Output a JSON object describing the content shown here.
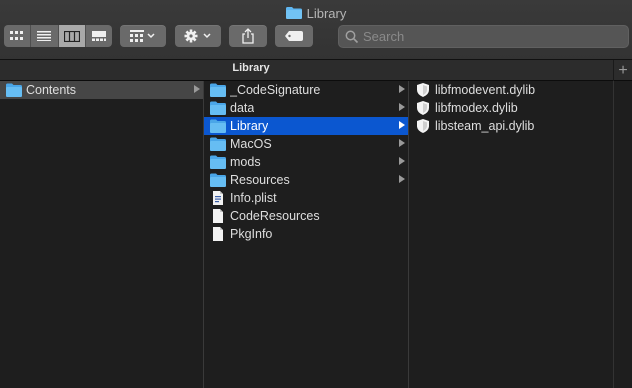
{
  "window": {
    "title": "Library"
  },
  "toolbar": {
    "views": [
      "icon-view",
      "list-view",
      "column-view",
      "gallery-view"
    ],
    "active_view": "column-view",
    "search": {
      "placeholder": "Search",
      "value": ""
    }
  },
  "pathbar": {
    "title": "Library"
  },
  "columns": [
    {
      "items": [
        {
          "label": "Contents",
          "type": "folder",
          "expandable": true,
          "state": "selected-inactive"
        }
      ]
    },
    {
      "items": [
        {
          "label": "_CodeSignature",
          "type": "folder",
          "expandable": true,
          "state": ""
        },
        {
          "label": "data",
          "type": "folder",
          "expandable": true,
          "state": ""
        },
        {
          "label": "Library",
          "type": "folder",
          "expandable": true,
          "state": "selected-active"
        },
        {
          "label": "MacOS",
          "type": "folder",
          "expandable": true,
          "state": ""
        },
        {
          "label": "mods",
          "type": "folder",
          "expandable": true,
          "state": ""
        },
        {
          "label": "Resources",
          "type": "folder",
          "expandable": true,
          "state": ""
        },
        {
          "label": "Info.plist",
          "type": "plist",
          "expandable": false,
          "state": ""
        },
        {
          "label": "CodeResources",
          "type": "file",
          "expandable": false,
          "state": ""
        },
        {
          "label": "PkgInfo",
          "type": "file",
          "expandable": false,
          "state": ""
        }
      ]
    },
    {
      "items": [
        {
          "label": "libfmodevent.dylib",
          "type": "dylib",
          "expandable": false,
          "state": ""
        },
        {
          "label": "libfmodex.dylib",
          "type": "dylib",
          "expandable": false,
          "state": ""
        },
        {
          "label": "libsteam_api.dylib",
          "type": "dylib",
          "expandable": false,
          "state": ""
        }
      ]
    }
  ],
  "colors": {
    "selection": "#0b57d0",
    "folder": "#5fb6f0",
    "inactive_selection": "#464646"
  }
}
